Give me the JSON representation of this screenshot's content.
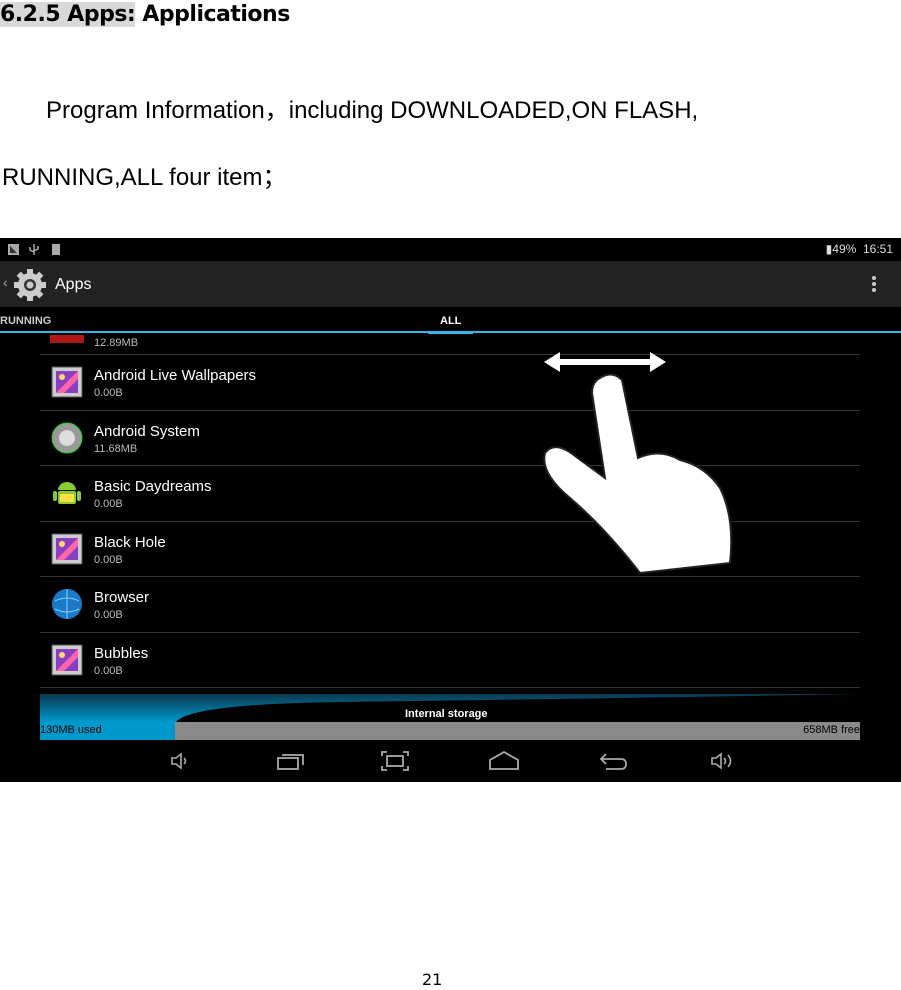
{
  "heading": {
    "highlighted": "6.2.5 Apps:",
    "rest": " Applications"
  },
  "paragraph": {
    "line1": "Program Information，including DOWNLOADED,ON FLASH,",
    "line2": "RUNNING,ALL four item；"
  },
  "screenshot": {
    "status": {
      "battery": "49%",
      "time": "16:51"
    },
    "actionbar": {
      "title": "Apps"
    },
    "tabs": [
      {
        "label": "RUNNING"
      },
      {
        "label": "ALL",
        "selected": true
      }
    ],
    "partial_item": {
      "size": "12.89MB"
    },
    "apps": [
      {
        "name": "Android Live Wallpapers",
        "size": "0.00B",
        "icon": "wallpaper-icon"
      },
      {
        "name": "Android System",
        "size": "11.68MB",
        "icon": "android-system-icon"
      },
      {
        "name": "Basic Daydreams",
        "size": "0.00B",
        "icon": "android-robot-icon"
      },
      {
        "name": "Black Hole",
        "size": "0.00B",
        "icon": "wallpaper-icon"
      },
      {
        "name": "Browser",
        "size": "0.00B",
        "icon": "globe-icon"
      },
      {
        "name": "Bubbles",
        "size": "0.00B",
        "icon": "wallpaper-icon"
      }
    ],
    "storage": {
      "label": "Internal storage",
      "used": "130MB used",
      "free": "658MB free",
      "used_fraction": 0.165
    },
    "colors": {
      "accent": "#33b5e5",
      "used_bar": "#0099cc",
      "free_bar": "#8a8a8a"
    }
  },
  "page_number": "21"
}
